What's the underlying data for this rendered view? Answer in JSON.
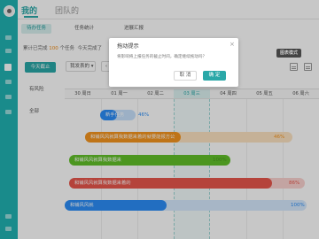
{
  "colors": {
    "accent": "#2aa8a8",
    "orange": "#f5951f",
    "green": "#62c12a",
    "red": "#e8574c",
    "blue": "#2c8ef8"
  },
  "nav": {
    "tabs": [
      "我的",
      "团队的"
    ]
  },
  "subtabs": [
    "待办任务",
    "任务统计",
    "进展汇报"
  ],
  "stats": {
    "label_overdue": "累计已完成",
    "overdue_count": "100",
    "unit": "个任务",
    "label_today": "今天完成了"
  },
  "filters": {
    "today_deadline": "今天截止",
    "risky": "有风险",
    "all": "全部"
  },
  "toolbar": {
    "select_label": "我发表的",
    "prev": "‹",
    "next": "›",
    "tooltip": "图表模式"
  },
  "icons": {
    "grid": "grid-view-icon",
    "calendar": "calendar-view-icon"
  },
  "gantt": {
    "days": [
      "30 周日",
      "01 周一",
      "02 周二",
      "03 周三",
      "04 周四",
      "05 周五",
      "06 周六"
    ],
    "today_index": 3
  },
  "tasks": [
    {
      "name": "新手任务",
      "progress": "46%",
      "color": "#2c8ef8"
    },
    {
      "name": "和铺风风就算我数据来着的就要能报方公",
      "progress": "46%",
      "color": "#f5951f"
    },
    {
      "name": "和铺风风就算我数据来",
      "progress": "100%",
      "color": "#62c12a"
    },
    {
      "name": "和铺风风就算我数据来着的",
      "progress": "86%",
      "color": "#e8574c"
    },
    {
      "name": "和铺风风就",
      "progress": "100%",
      "color": "#2c8ef8"
    }
  ],
  "dialog": {
    "title": "拖动提示",
    "message": "将影响将上报任务的截止时间，确定继续拖动吗？",
    "cancel": "取 消",
    "confirm": "确 定"
  }
}
